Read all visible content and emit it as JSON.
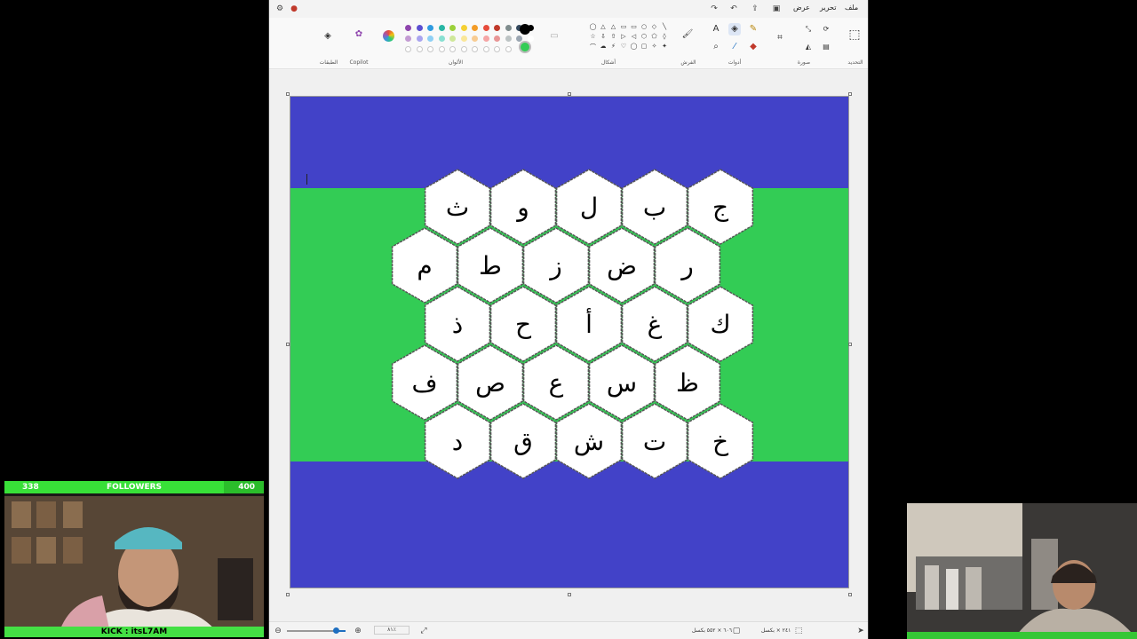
{
  "paint": {
    "menu": [
      "ملف",
      "تحرير",
      "عرض"
    ],
    "groups": {
      "selection": "التحديد",
      "image": "صورة",
      "tools": "أدوات",
      "brushes": "الفرش",
      "shapes": "أشكال",
      "colors": "الألوان",
      "copilot": "Copilot",
      "layers": "الطبقات"
    },
    "palette_row1": [
      "#8e44ad",
      "#5b4fd1",
      "#2f9be0",
      "#29b6a4",
      "#9bd13a",
      "#f5d033",
      "#f39c27",
      "#e74c3c",
      "#c0392b",
      "#7f8c8d",
      "#34495e",
      "#000000"
    ],
    "palette_row2": [
      "#c39bd3",
      "#a9a4ef",
      "#8fd0f5",
      "#88e0d2",
      "#cfe89a",
      "#fae79a",
      "#f8cc93",
      "#f5a5a5",
      "#e89595",
      "#bcc3c4",
      "#9aa5b1",
      "#ffffff"
    ],
    "primary_color": "#000000",
    "secondary_color": "#33cc55",
    "status": {
      "canvas_size": "٦٠٦ × ٥٥٢ بكسل",
      "selection_size": "٢٤١ × بكسل",
      "zoom": "٨١٪"
    },
    "colors": {
      "canvas_blue": "#4242c8",
      "canvas_green": "#33cc55",
      "hex_fill": "#ffffff",
      "hex_stroke": "#555555"
    }
  },
  "board": {
    "rows": [
      [
        "ث",
        "و",
        "ل",
        "ب",
        "ج"
      ],
      [
        "م",
        "ط",
        "ز",
        "ض",
        "ر"
      ],
      [
        "ذ",
        "ح",
        "أ",
        "غ",
        "ك"
      ],
      [
        "ف",
        "ص",
        "ع",
        "س",
        "ظ"
      ],
      [
        "د",
        "ق",
        "ش",
        "ت",
        "خ"
      ]
    ]
  },
  "stream": {
    "followers_current": "338",
    "followers_label": "FOLLOWERS",
    "followers_goal": "400",
    "followers_progress": 0.845,
    "kick_tag": "KICK : itsL7AM"
  }
}
